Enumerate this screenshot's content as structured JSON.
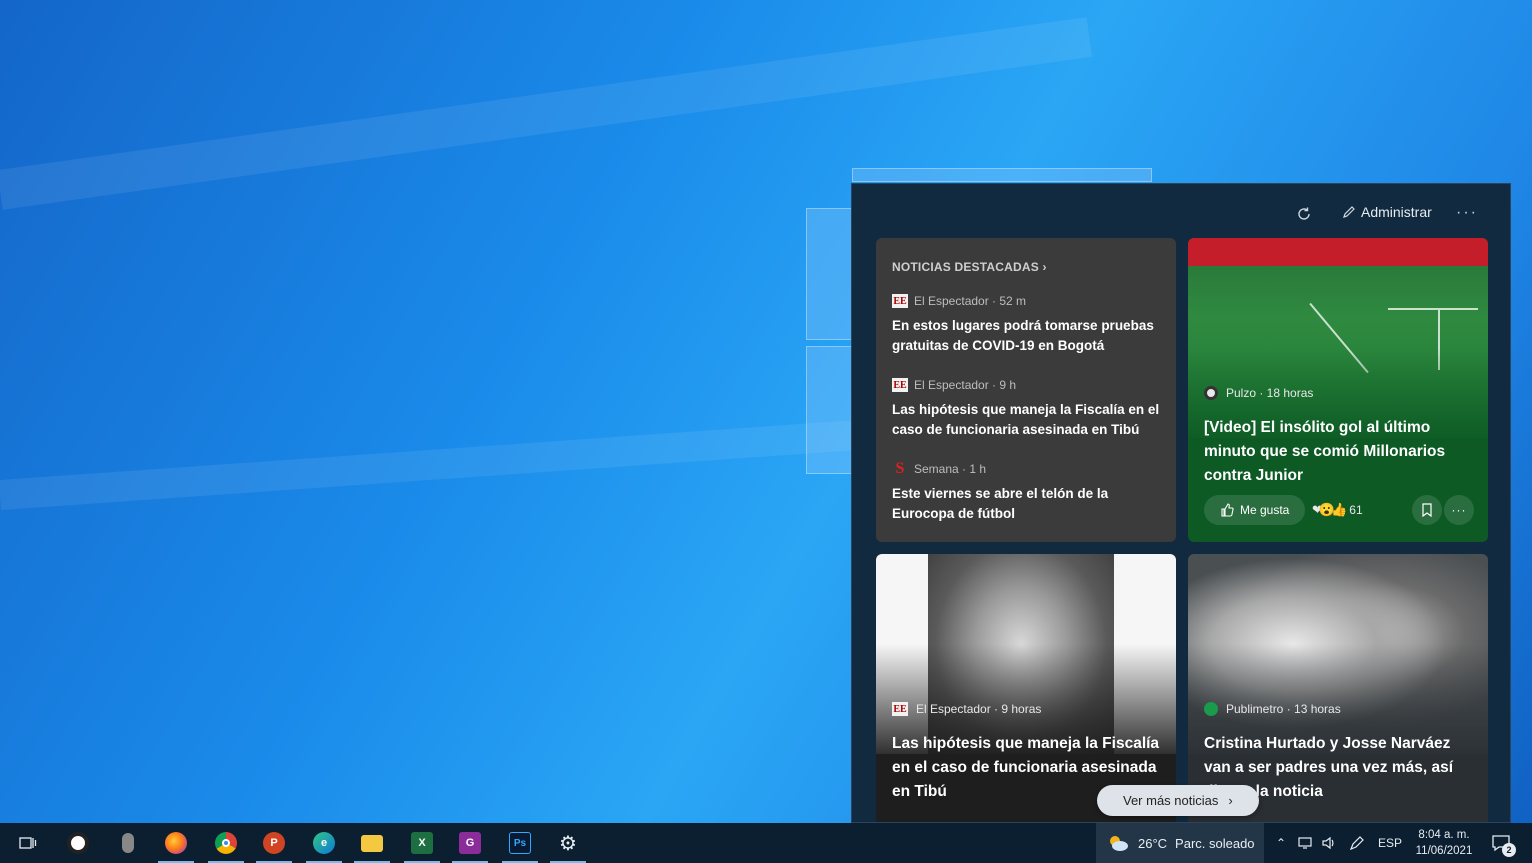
{
  "news_panel": {
    "manage_label": "Administrar",
    "more_label": "···",
    "top_stories": {
      "section_title": "NOTICIAS DESTACADAS",
      "items": [
        {
          "source": "El Espectador · 52 m",
          "title": "En estos lugares podrá tomarse pruebas gratuitas de COVID-19 en Bogotá"
        },
        {
          "source": "El Espectador · 9 h",
          "title": "Las hipótesis que maneja la Fiscalía en el caso de funcionaria asesinada en Tibú"
        },
        {
          "source": "Semana · 1 h",
          "title": "Este viernes se abre el telón de la Eurocopa de fútbol"
        }
      ],
      "logo_ee": "EE",
      "logo_semana": "S"
    },
    "sport_card": {
      "source": "Pulzo · 18 horas",
      "title": "[Video] El insólito gol al último minuto que se comió Millonarios contra Junior",
      "like_label": "Me gusta",
      "reaction_count": "61",
      "reactions_emoji": "❤😮👍"
    },
    "portrait_card": {
      "source": "El Espectador · 9 horas",
      "title": "Las hipótesis que maneja la Fiscalía en el caso de funcionaria asesinada en Tibú"
    },
    "couple_card": {
      "source": "Publimetro · 13 horas",
      "title": "Cristina Hurtado y Josse Narváez van a ser padres una vez más, así dieron la noticia"
    },
    "see_more_label": "Ver más noticias"
  },
  "taskbar": {
    "apps": [
      {
        "name": "task-view",
        "glyph": "⊟"
      },
      {
        "name": "recorder",
        "glyph": "◉"
      },
      {
        "name": "microphone",
        "glyph": "🎙"
      },
      {
        "name": "firefox",
        "glyph": "🦊"
      },
      {
        "name": "chrome",
        "glyph": "●"
      },
      {
        "name": "powerpoint",
        "glyph": "P"
      },
      {
        "name": "edge",
        "glyph": "e"
      },
      {
        "name": "file-explorer",
        "glyph": "📁"
      },
      {
        "name": "excel",
        "glyph": "X"
      },
      {
        "name": "pdf-app",
        "glyph": "G"
      },
      {
        "name": "photoshop",
        "glyph": "Ps"
      },
      {
        "name": "settings",
        "glyph": "⚙"
      }
    ],
    "weather": {
      "temp": "26°C",
      "condition": "Parc. soleado"
    },
    "language": "ESP",
    "time": "8:04 a. m.",
    "date": "11/06/2021",
    "notification_count": "2"
  },
  "colors": {
    "panel_bg": "#122a3f",
    "taskbar_bg": "#0c1f30",
    "sport_card_bg": "#0d5a25"
  }
}
